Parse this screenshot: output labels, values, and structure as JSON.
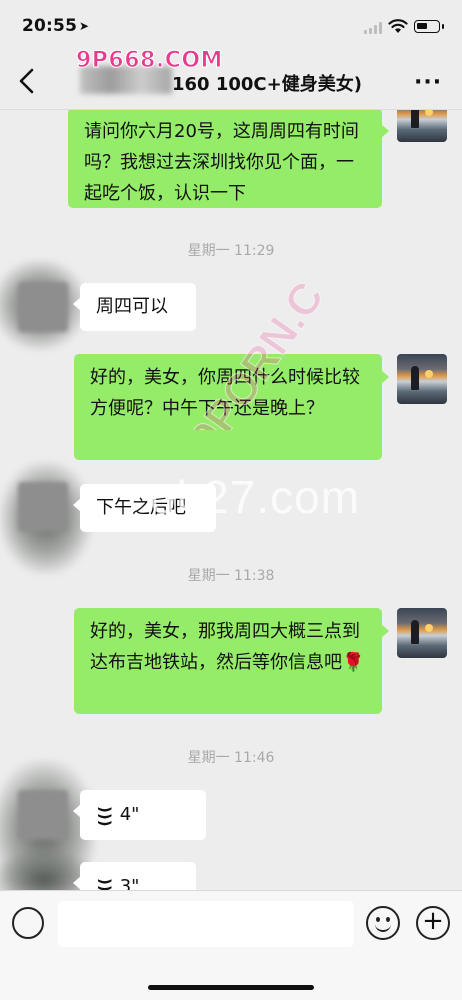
{
  "status": {
    "time": "20:55"
  },
  "header": {
    "title_visible": "160 100C+健身美女)",
    "watermark": "9P668.COM"
  },
  "messages": [
    {
      "type": "out",
      "text": "请问你六月20号，这周周四有时间吗？我想过去深圳找你见个面，一起吃个饭，认识一下"
    },
    {
      "type": "time",
      "text": "星期一 11:29"
    },
    {
      "type": "in",
      "text": "周四可以"
    },
    {
      "type": "out",
      "text": "好的，美女，你周四什么时候比较方便呢？中午下午还是晚上？"
    },
    {
      "type": "in",
      "text": "下午之后吧"
    },
    {
      "type": "time",
      "text": "星期一 11:38"
    },
    {
      "type": "out",
      "text": "好的，美女，那我周四大概三点到达布吉地铁站，然后等你信息吧🌹"
    },
    {
      "type": "time",
      "text": "星期一 11:46"
    },
    {
      "type": "voice",
      "duration": "4\""
    },
    {
      "type": "voice",
      "duration": "3\""
    }
  ],
  "overlay_watermarks": [
    "9PORN.C",
    "ob27.com"
  ],
  "colors": {
    "bubble_out": "#95ec69",
    "bubble_in": "#ffffff",
    "background": "#ededed"
  },
  "icons": [
    "location-arrow-icon",
    "signal-icon",
    "wifi-icon",
    "battery-icon",
    "back-chevron-icon",
    "more-icon",
    "voice-wave-icon",
    "voice-toggle-icon",
    "emoji-icon",
    "plus-icon"
  ]
}
